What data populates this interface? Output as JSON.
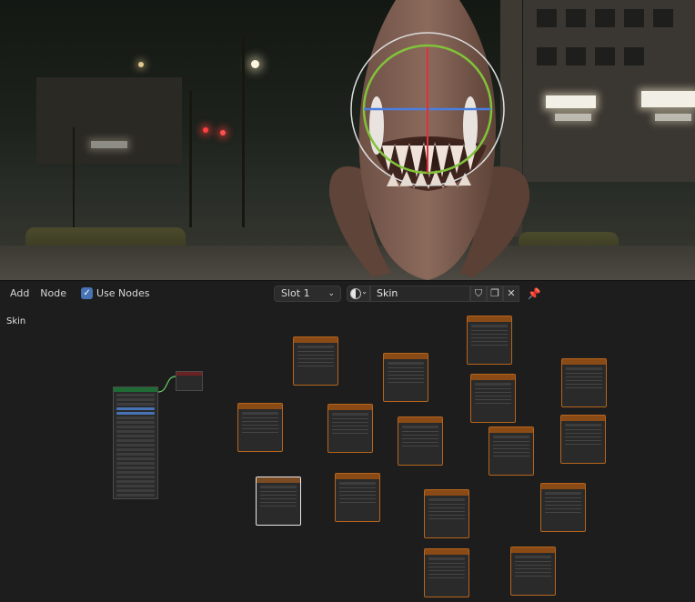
{
  "header": {
    "menus": [
      "Add",
      "Node"
    ],
    "use_nodes_label": "Use Nodes",
    "use_nodes_checked": true,
    "slot_label": "Slot 1",
    "material_name": "Skin"
  },
  "editor": {
    "material_label": "Skin"
  },
  "colors": {
    "accent": "#4772b3",
    "node_border": "#b5651d",
    "shader_node_header": "#1e6b35",
    "output_node_header": "#6b2222"
  },
  "icons": [
    "checkbox-icon",
    "material-sphere-icon",
    "chevron-down-icon",
    "fake-user-shield-icon",
    "duplicate-icon",
    "close-icon",
    "pin-icon"
  ]
}
